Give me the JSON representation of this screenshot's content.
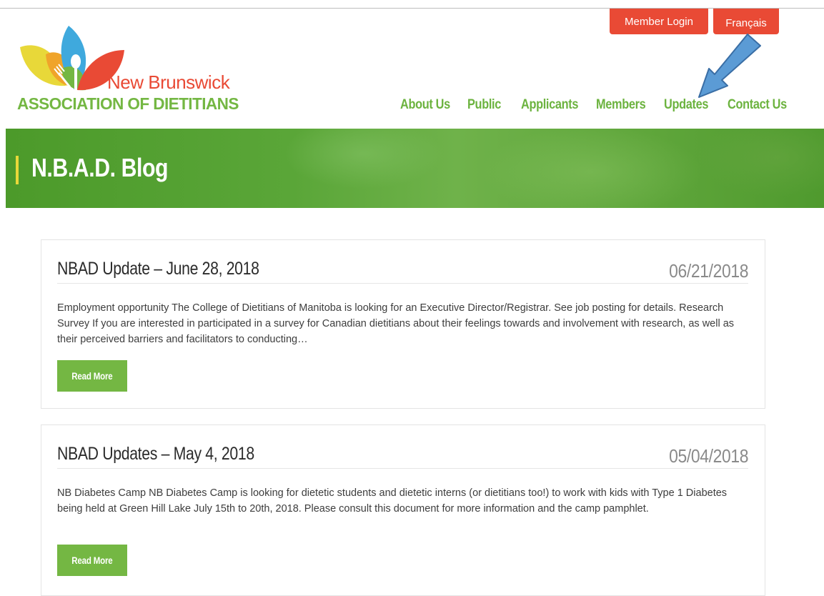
{
  "utility": {
    "member_login": "Member Login",
    "french": "Français"
  },
  "logo": {
    "line1": "New Brunswick",
    "line2": "ASSOCIATION OF DIETITIANS",
    "colors": {
      "red": "#e94a35",
      "green": "#74b743",
      "yellow": "#e8d839",
      "blue": "#3fa9dd",
      "orange": "#f0a42a"
    }
  },
  "nav": {
    "items": [
      {
        "label": "About Us"
      },
      {
        "label": "Public"
      },
      {
        "label": "Applicants"
      },
      {
        "label": "Members"
      },
      {
        "label": "Updates"
      },
      {
        "label": "Contact Us"
      }
    ]
  },
  "hero": {
    "title": "N.B.A.D. Blog"
  },
  "posts": [
    {
      "title": "NBAD Update – June 28, 2018",
      "date": "06/21/2018",
      "excerpt": "Employment opportunity The College of Dietitians of Manitoba is looking for an Executive Director/Registrar.  See job posting for details. Research Survey If you are interested in participated in a survey for Canadian dietitians about their feelings towards and involvement with research, as well as their perceived barriers and facilitators to conducting…",
      "read_more": "Read More"
    },
    {
      "title": "NBAD Updates – May 4, 2018",
      "date": "05/04/2018",
      "excerpt": "NB Diabetes Camp NB Diabetes Camp is looking for dietetic students and dietetic interns (or dietitians too!) to work with kids with Type 1 Diabetes being held at Green Hill Lake July 15th to 20th, 2018. Please consult this document for more information and the camp pamphlet.",
      "read_more": "Read More"
    }
  ],
  "annotation": {
    "arrow_color": "#5b9bd5",
    "arrow_icon": "arrow-down-left-icon"
  }
}
